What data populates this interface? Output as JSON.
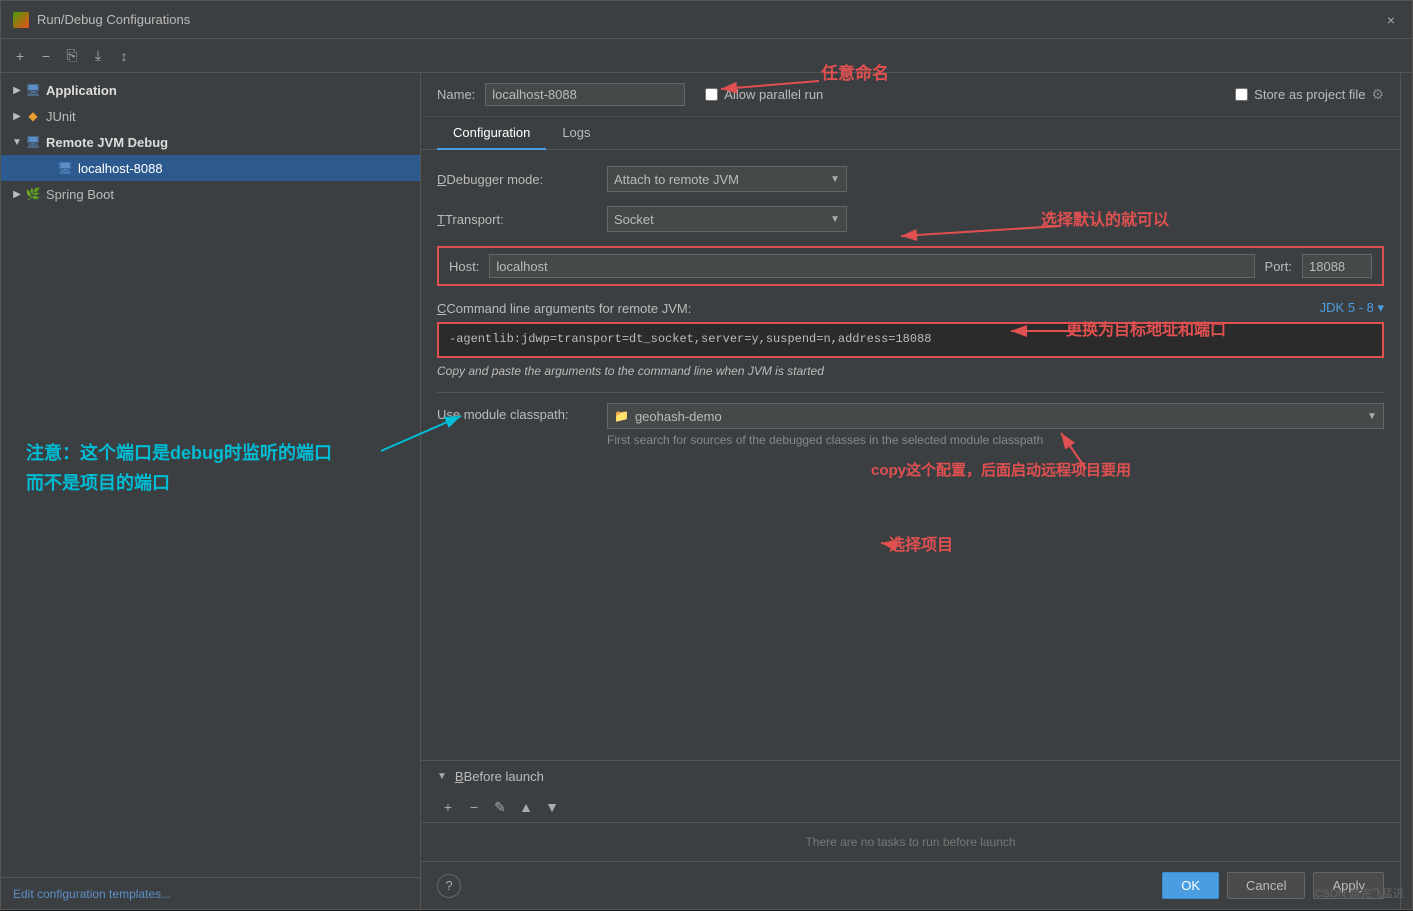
{
  "dialog": {
    "title": "Run/Debug Configurations",
    "close_label": "×"
  },
  "toolbar": {
    "add_label": "+",
    "remove_label": "−",
    "copy_label": "⎘",
    "move_label": "⤓",
    "sort_label": "↕"
  },
  "sidebar": {
    "items": [
      {
        "id": "application",
        "label": "Application",
        "level": 1,
        "expand": "▶",
        "icon": "🖥",
        "bold": true
      },
      {
        "id": "junit",
        "label": "JUnit",
        "level": 1,
        "expand": "▶",
        "icon": "◆",
        "color": "#e8a030"
      },
      {
        "id": "remote-jvm-debug",
        "label": "Remote JVM Debug",
        "level": 1,
        "expand": "▼",
        "icon": "🖥",
        "bold": true
      },
      {
        "id": "localhost-8088",
        "label": "localhost-8088",
        "level": 2,
        "expand": "",
        "icon": "🖥",
        "selected": true
      },
      {
        "id": "spring-boot",
        "label": "Spring Boot",
        "level": 1,
        "expand": "▶",
        "icon": "🌿",
        "color": "#4e9a06"
      }
    ],
    "edit_templates": "Edit configuration templates..."
  },
  "name_row": {
    "name_label": "Name:",
    "name_value": "localhost-8088",
    "allow_parallel_label": "Allow parallel run",
    "store_project_label": "Store as project file"
  },
  "tabs": [
    {
      "id": "configuration",
      "label": "Configuration",
      "active": true
    },
    {
      "id": "logs",
      "label": "Logs",
      "active": false
    }
  ],
  "config": {
    "debugger_mode_label": "Debugger mode:",
    "debugger_mode_value": "Attach to remote JVM",
    "transport_label": "Transport:",
    "transport_value": "Socket",
    "host_label": "Host:",
    "host_value": "localhost",
    "port_label": "Port:",
    "port_value": "18088",
    "cmd_args_label": "Command line arguments for remote JVM:",
    "cmd_args_value": "-agentlib:jdwp=transport=dt_socket,server=y,suspend=n,address=18088",
    "copy_hint": "Copy and paste the arguments to the command line when JVM is started",
    "jdk_version": "JDK 5 - 8 ▾",
    "module_label": "Use module classpath:",
    "module_value": "geohash-demo",
    "module_hint": "First search for sources of the debugged classes in the selected module classpath"
  },
  "before_launch": {
    "title": "Before launch",
    "empty_label": "There are no tasks to run before launch"
  },
  "footer": {
    "ok_label": "OK",
    "cancel_label": "Cancel",
    "apply_label": "Apply",
    "help_label": "?"
  },
  "annotations": {
    "name_annotation": "任意命名",
    "debugger_annotation": "选择默认的就可以",
    "host_annotation": "更换为目标地址和端口",
    "notice_line1": "注意：这个端口是debug时监听的端口",
    "notice_line2": "而不是项目的端口",
    "copy_annotation": "copy这个配置，后面启动远程项目要用",
    "module_annotation": "选择项目"
  },
  "watermark": "CSDN @完飞猛进"
}
